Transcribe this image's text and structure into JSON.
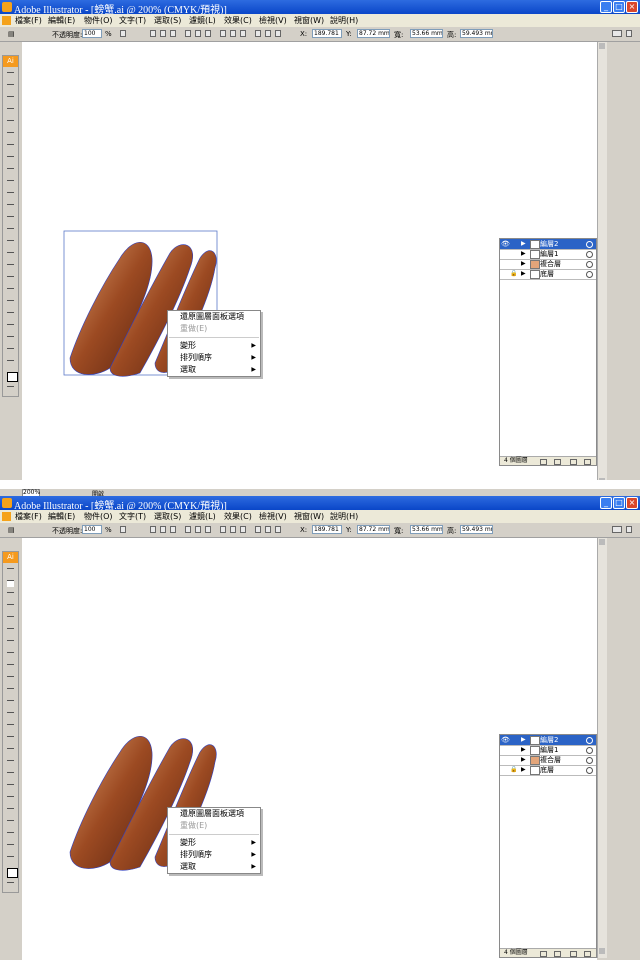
{
  "title": "Adobe Illustrator - [螃蟹.ai @ 200% (CMYK/預視)]",
  "menus": [
    "檔案(F)",
    "編輯(E)",
    "物件(O)",
    "文字(T)",
    "選取(S)",
    "濾鏡(L)",
    "效果(C)",
    "檢視(V)",
    "視窗(W)",
    "說明(H)"
  ],
  "control": {
    "opacity_label": "不透明度:",
    "opacity_value": "100",
    "percent": "%",
    "x_label": "X:",
    "x_value": "189.781 mm",
    "y_label": "Y:",
    "y_value": "87.72 mm",
    "w_label": "寬:",
    "w_value": "53.66 mm",
    "h_label": "高:",
    "h_value": "59.493 mm"
  },
  "toolbox_header": "Ai",
  "layers": [
    {
      "name": "編層2",
      "selected": true
    },
    {
      "name": "編層1",
      "selected": false
    },
    {
      "name": "複合層",
      "selected": false
    },
    {
      "name": "底層",
      "selected": false
    }
  ],
  "layers_count": "4 個圖層",
  "context_menu": [
    {
      "label": "還原圖層面板選項",
      "disabled": false
    },
    {
      "label": "重做(E)",
      "disabled": true
    },
    {
      "label": "變形",
      "submenu": true
    },
    {
      "label": "排列順序",
      "submenu": true
    },
    {
      "label": "選取",
      "submenu": true
    }
  ],
  "status": {
    "zoom": "200%",
    "state": "開啟"
  },
  "colors": {
    "title_bar": "#0a46c8",
    "toolbox_accent": "#f59a1e",
    "selection_blue": "#2b63c6",
    "shape_brown": "#9c4a22"
  }
}
